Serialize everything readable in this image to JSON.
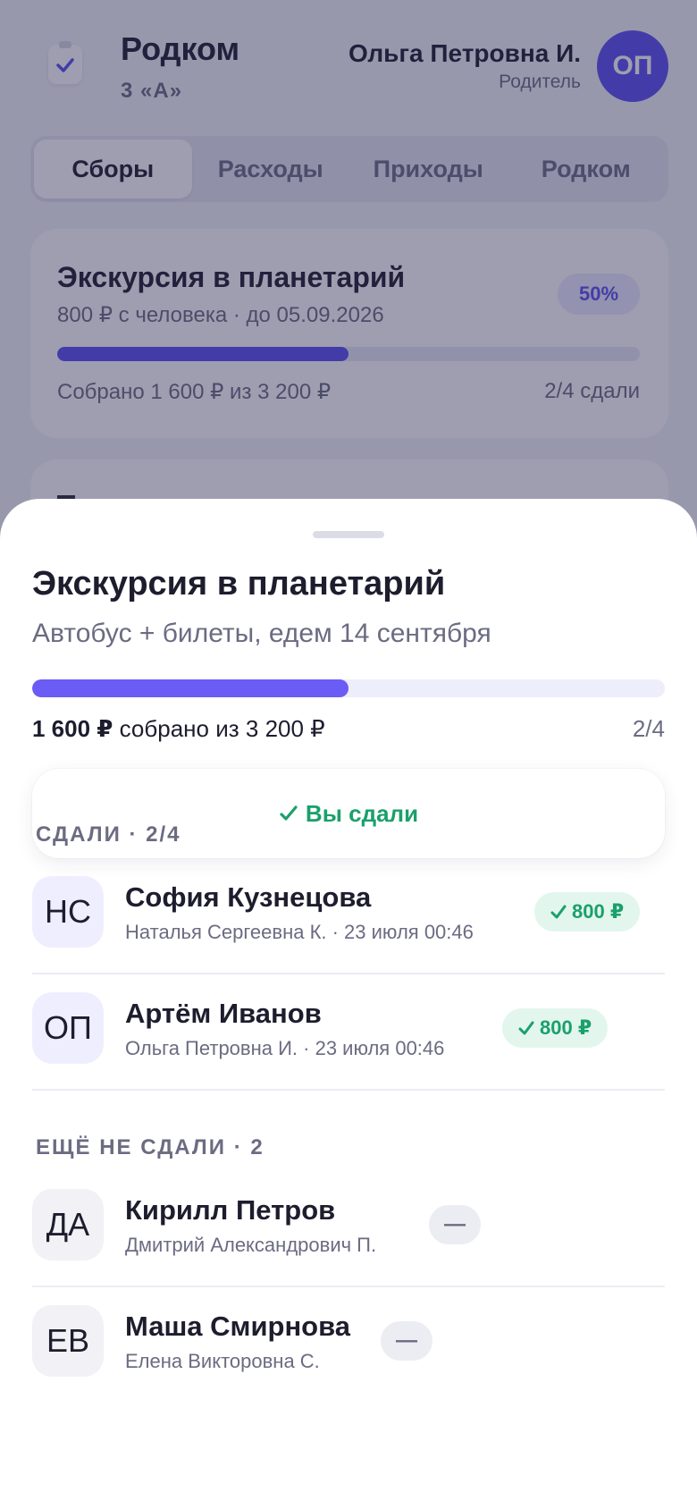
{
  "header": {
    "title": "Родком",
    "class_name": "3 «А»",
    "user_name": "Ольга Петровна И.",
    "user_role": "Родитель",
    "avatar_initials": "ОП"
  },
  "tabs": [
    {
      "label": "Сборы",
      "active": true
    },
    {
      "label": "Расходы",
      "active": false
    },
    {
      "label": "Приходы",
      "active": false
    },
    {
      "label": "Родком",
      "active": false
    }
  ],
  "collection_card": {
    "title": "Экскурсия в планетарий",
    "subtitle": "800 ₽ с человека · до 05.09.2026",
    "percent_label": "50%",
    "progress": 0.5,
    "collected_text": "Собрано 1 600 ₽ из 3 200 ₽",
    "count_text": "2/4 сдали"
  },
  "sheet": {
    "title": "Экскурсия в планетарий",
    "description": "Автобус + билеты, едем 14 сентября",
    "progress": 0.5,
    "amount_bold": "1 600 ₽",
    "amount_rest": " собрано из 3 200 ₽",
    "count": "2/4",
    "paid_status": "Вы сдали",
    "paid_section_label": "СДАЛИ · 2/4",
    "unpaid_section_label": "ЕЩЁ НЕ СДАЛИ · 2",
    "paid": [
      {
        "initials": "НС",
        "child": "София Кузнецова",
        "meta": "Наталья Сергеевна К. · 23 июля 00:46",
        "amount": "800 ₽"
      },
      {
        "initials": "ОП",
        "child": "Артём Иванов",
        "meta": "Ольга Петровна И. · 23 июля 00:46",
        "amount": "800 ₽"
      }
    ],
    "unpaid": [
      {
        "initials": "ДА",
        "child": "Кирилл Петров",
        "meta": "Дмитрий Александрович П.",
        "status": "—"
      },
      {
        "initials": "ЕВ",
        "child": "Маша Смирнова",
        "meta": "Елена Викторовна С.",
        "status": "—"
      }
    ]
  },
  "colors": {
    "accent": "#5a4df0",
    "success": "#1aa06b",
    "text": "#1d1d2e",
    "muted": "#6b6b82"
  },
  "icons": {
    "logo": "clipboard-check-icon",
    "paid_check": "check-icon"
  }
}
